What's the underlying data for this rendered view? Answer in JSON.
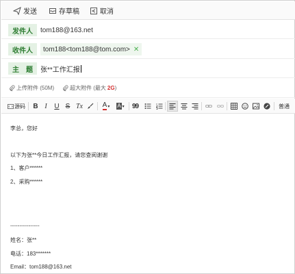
{
  "actions": {
    "send": "发送",
    "save_draft": "存草稿",
    "cancel": "取消"
  },
  "fields": {
    "from_label": "发件人",
    "from_value": "tom188@163.net",
    "to_label": "收件人",
    "to_chip": "tom188<tom188@tom.com>",
    "subject_label": "主　题",
    "subject_value": "张**工作汇报"
  },
  "attachments": {
    "upload": "上传附件 (50M)",
    "large_prefix": "超大附件 (最大",
    "large_size": "2G",
    "large_suffix": ")"
  },
  "toolbar": {
    "source": "源码",
    "bold": "B",
    "italic": "I",
    "underline": "U",
    "strike": "S",
    "clear_format": "Tx",
    "font_color": "A",
    "bg_color": "A",
    "quote": "99",
    "plain": "普通"
  },
  "body": {
    "lines": [
      "李总，您好",
      "以下为张**今日工作汇报，请您查阅谢谢",
      "1、客户******",
      "2、采购******",
      "----------------",
      "姓名：张**",
      "电话：183*******",
      "Email：tom188@163.net"
    ]
  }
}
